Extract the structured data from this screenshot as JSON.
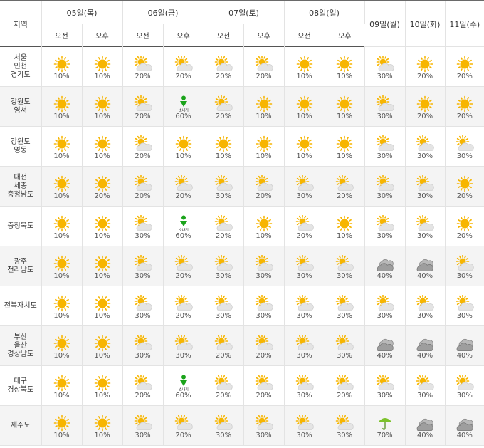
{
  "header": {
    "region_label": "지역",
    "days": [
      {
        "label": "05일(목)",
        "split": true
      },
      {
        "label": "06일(금)",
        "split": true
      },
      {
        "label": "07일(토)",
        "split": true
      },
      {
        "label": "08일(일)",
        "split": true
      },
      {
        "label": "09일(월)",
        "split": false
      },
      {
        "label": "10일(화)",
        "split": false
      },
      {
        "label": "11일(수)",
        "split": false
      }
    ],
    "am_label": "오전",
    "pm_label": "오후"
  },
  "shower_label": "소나기",
  "rows": [
    {
      "region": [
        "서울",
        "인천",
        "경기도"
      ],
      "cells": [
        {
          "icon": "sunny",
          "pct": "10%"
        },
        {
          "icon": "sunny",
          "pct": "10%"
        },
        {
          "icon": "partly-cloudy",
          "pct": "20%"
        },
        {
          "icon": "partly-cloudy",
          "pct": "20%"
        },
        {
          "icon": "partly-cloudy",
          "pct": "20%"
        },
        {
          "icon": "partly-cloudy",
          "pct": "20%"
        },
        {
          "icon": "sunny",
          "pct": "10%"
        },
        {
          "icon": "sunny",
          "pct": "10%"
        },
        {
          "icon": "partly-cloudy",
          "pct": "30%"
        },
        {
          "icon": "sunny",
          "pct": "20%"
        },
        {
          "icon": "sunny",
          "pct": "20%"
        }
      ]
    },
    {
      "region": [
        "강원도",
        "영서"
      ],
      "cells": [
        {
          "icon": "sunny",
          "pct": "10%"
        },
        {
          "icon": "sunny",
          "pct": "10%"
        },
        {
          "icon": "partly-cloudy",
          "pct": "20%"
        },
        {
          "icon": "shower",
          "pct": "60%"
        },
        {
          "icon": "partly-cloudy",
          "pct": "20%"
        },
        {
          "icon": "sunny",
          "pct": "10%"
        },
        {
          "icon": "sunny",
          "pct": "10%"
        },
        {
          "icon": "sunny",
          "pct": "10%"
        },
        {
          "icon": "partly-cloudy",
          "pct": "30%"
        },
        {
          "icon": "sunny",
          "pct": "20%"
        },
        {
          "icon": "sunny",
          "pct": "20%"
        }
      ]
    },
    {
      "region": [
        "강원도",
        "영동"
      ],
      "cells": [
        {
          "icon": "sunny",
          "pct": "10%"
        },
        {
          "icon": "sunny",
          "pct": "10%"
        },
        {
          "icon": "partly-cloudy",
          "pct": "20%"
        },
        {
          "icon": "sunny",
          "pct": "10%"
        },
        {
          "icon": "sunny",
          "pct": "10%"
        },
        {
          "icon": "sunny",
          "pct": "10%"
        },
        {
          "icon": "sunny",
          "pct": "10%"
        },
        {
          "icon": "sunny",
          "pct": "10%"
        },
        {
          "icon": "partly-cloudy",
          "pct": "30%"
        },
        {
          "icon": "partly-cloudy",
          "pct": "30%"
        },
        {
          "icon": "partly-cloudy",
          "pct": "30%"
        }
      ]
    },
    {
      "region": [
        "대전",
        "세종",
        "충청남도"
      ],
      "cells": [
        {
          "icon": "sunny",
          "pct": "10%"
        },
        {
          "icon": "sunny",
          "pct": "20%"
        },
        {
          "icon": "partly-cloudy",
          "pct": "20%"
        },
        {
          "icon": "partly-cloudy",
          "pct": "20%"
        },
        {
          "icon": "partly-cloudy",
          "pct": "30%"
        },
        {
          "icon": "partly-cloudy",
          "pct": "20%"
        },
        {
          "icon": "partly-cloudy",
          "pct": "30%"
        },
        {
          "icon": "partly-cloudy",
          "pct": "20%"
        },
        {
          "icon": "partly-cloudy",
          "pct": "30%"
        },
        {
          "icon": "partly-cloudy",
          "pct": "30%"
        },
        {
          "icon": "sunny",
          "pct": "20%"
        }
      ]
    },
    {
      "region": [
        "충청북도"
      ],
      "cells": [
        {
          "icon": "sunny",
          "pct": "10%"
        },
        {
          "icon": "sunny",
          "pct": "10%"
        },
        {
          "icon": "partly-cloudy",
          "pct": "30%"
        },
        {
          "icon": "shower",
          "pct": "60%"
        },
        {
          "icon": "partly-cloudy",
          "pct": "20%"
        },
        {
          "icon": "sunny",
          "pct": "10%"
        },
        {
          "icon": "partly-cloudy",
          "pct": "20%"
        },
        {
          "icon": "sunny",
          "pct": "10%"
        },
        {
          "icon": "partly-cloudy",
          "pct": "30%"
        },
        {
          "icon": "partly-cloudy",
          "pct": "30%"
        },
        {
          "icon": "sunny",
          "pct": "20%"
        }
      ]
    },
    {
      "region": [
        "광주",
        "전라남도"
      ],
      "cells": [
        {
          "icon": "sunny",
          "pct": "10%"
        },
        {
          "icon": "sunny",
          "pct": "10%"
        },
        {
          "icon": "partly-cloudy",
          "pct": "30%"
        },
        {
          "icon": "partly-cloudy",
          "pct": "20%"
        },
        {
          "icon": "partly-cloudy",
          "pct": "30%"
        },
        {
          "icon": "partly-cloudy",
          "pct": "30%"
        },
        {
          "icon": "partly-cloudy",
          "pct": "30%"
        },
        {
          "icon": "partly-cloudy",
          "pct": "30%"
        },
        {
          "icon": "cloudy",
          "pct": "40%"
        },
        {
          "icon": "cloudy",
          "pct": "40%"
        },
        {
          "icon": "partly-cloudy",
          "pct": "30%"
        }
      ]
    },
    {
      "region": [
        "전북자치도"
      ],
      "cells": [
        {
          "icon": "sunny",
          "pct": "10%"
        },
        {
          "icon": "sunny",
          "pct": "10%"
        },
        {
          "icon": "partly-cloudy",
          "pct": "30%"
        },
        {
          "icon": "partly-cloudy",
          "pct": "20%"
        },
        {
          "icon": "partly-cloudy",
          "pct": "30%"
        },
        {
          "icon": "partly-cloudy",
          "pct": "30%"
        },
        {
          "icon": "partly-cloudy",
          "pct": "30%"
        },
        {
          "icon": "partly-cloudy",
          "pct": "30%"
        },
        {
          "icon": "partly-cloudy",
          "pct": "30%"
        },
        {
          "icon": "partly-cloudy",
          "pct": "30%"
        },
        {
          "icon": "partly-cloudy",
          "pct": "30%"
        }
      ]
    },
    {
      "region": [
        "부산",
        "울산",
        "경상남도"
      ],
      "cells": [
        {
          "icon": "sunny",
          "pct": "10%"
        },
        {
          "icon": "sunny",
          "pct": "10%"
        },
        {
          "icon": "partly-cloudy",
          "pct": "30%"
        },
        {
          "icon": "partly-cloudy",
          "pct": "30%"
        },
        {
          "icon": "partly-cloudy",
          "pct": "20%"
        },
        {
          "icon": "partly-cloudy",
          "pct": "20%"
        },
        {
          "icon": "partly-cloudy",
          "pct": "30%"
        },
        {
          "icon": "partly-cloudy",
          "pct": "30%"
        },
        {
          "icon": "cloudy",
          "pct": "40%"
        },
        {
          "icon": "cloudy",
          "pct": "40%"
        },
        {
          "icon": "cloudy",
          "pct": "40%"
        }
      ]
    },
    {
      "region": [
        "대구",
        "경상북도"
      ],
      "cells": [
        {
          "icon": "sunny",
          "pct": "10%"
        },
        {
          "icon": "sunny",
          "pct": "10%"
        },
        {
          "icon": "partly-cloudy",
          "pct": "20%"
        },
        {
          "icon": "shower",
          "pct": "60%"
        },
        {
          "icon": "partly-cloudy",
          "pct": "20%"
        },
        {
          "icon": "partly-cloudy",
          "pct": "20%"
        },
        {
          "icon": "partly-cloudy",
          "pct": "30%"
        },
        {
          "icon": "partly-cloudy",
          "pct": "20%"
        },
        {
          "icon": "partly-cloudy",
          "pct": "30%"
        },
        {
          "icon": "partly-cloudy",
          "pct": "30%"
        },
        {
          "icon": "partly-cloudy",
          "pct": "30%"
        }
      ]
    },
    {
      "region": [
        "제주도"
      ],
      "cells": [
        {
          "icon": "sunny",
          "pct": "10%"
        },
        {
          "icon": "sunny",
          "pct": "10%"
        },
        {
          "icon": "partly-cloudy",
          "pct": "30%"
        },
        {
          "icon": "partly-cloudy",
          "pct": "20%"
        },
        {
          "icon": "partly-cloudy",
          "pct": "30%"
        },
        {
          "icon": "partly-cloudy",
          "pct": "30%"
        },
        {
          "icon": "partly-cloudy",
          "pct": "30%"
        },
        {
          "icon": "partly-cloudy",
          "pct": "30%"
        },
        {
          "icon": "rain-umbrella",
          "pct": "70%"
        },
        {
          "icon": "cloudy",
          "pct": "40%"
        },
        {
          "icon": "cloudy",
          "pct": "40%"
        }
      ]
    }
  ],
  "colors": {
    "sun": "#f7b500",
    "cloud_light": "#e4e4e4",
    "cloud_dark": "#9e9e9e",
    "shower_green": "#1aa31a",
    "umbrella_green": "#7cc22b",
    "row_alt": "#f4f4f4"
  }
}
